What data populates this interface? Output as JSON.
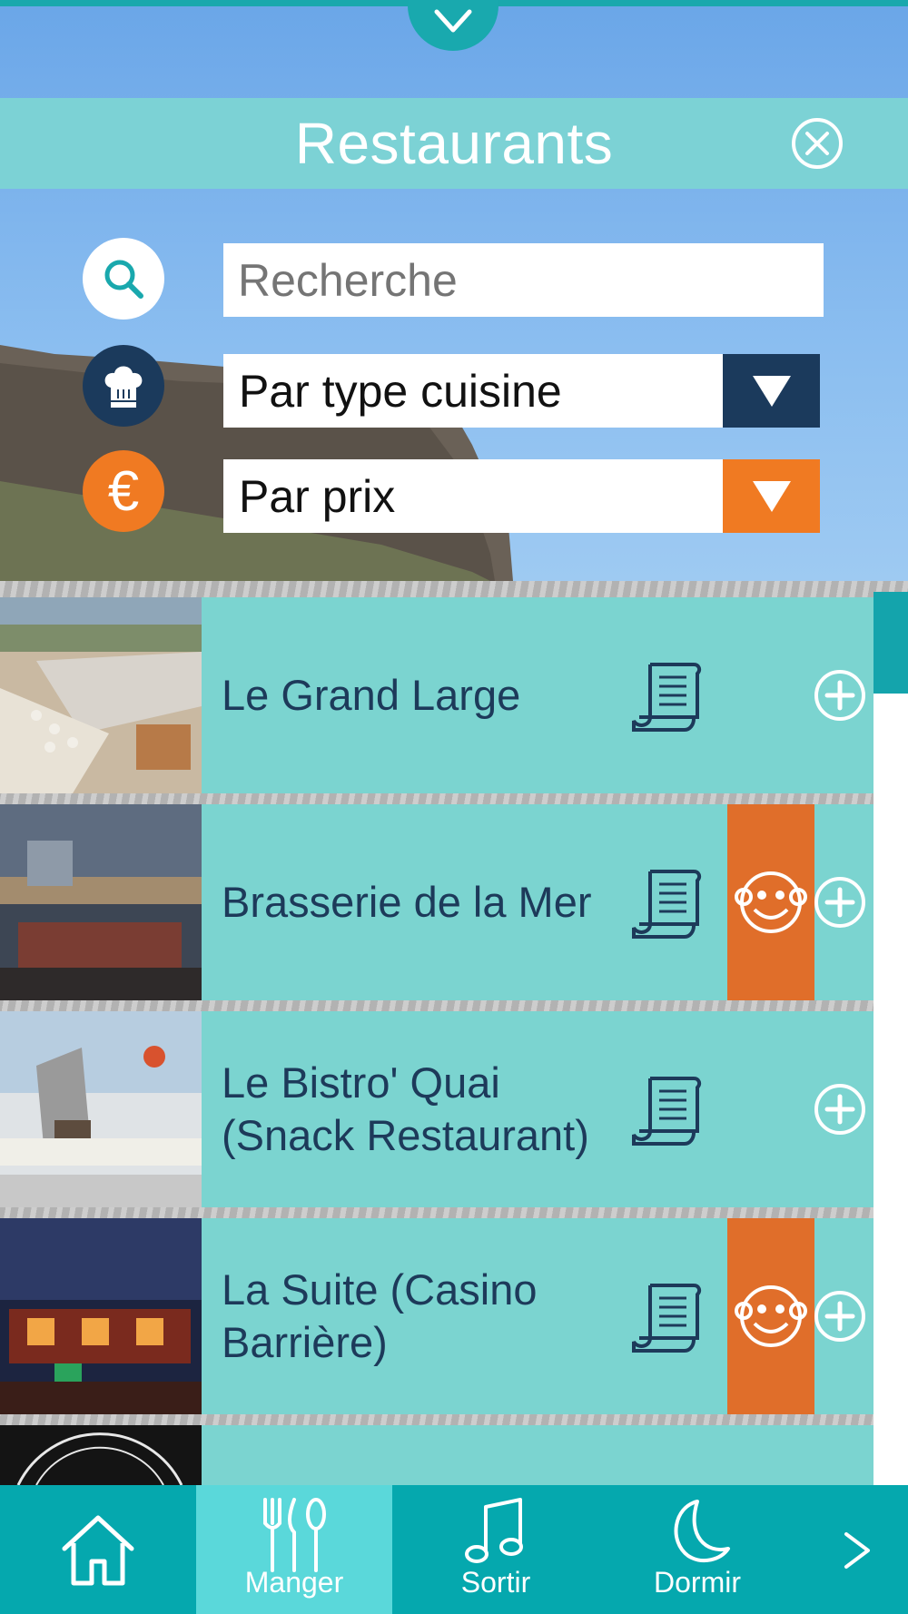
{
  "header": {
    "title": "Restaurants",
    "close_icon": "close-circle-icon",
    "pull_icon": "chevron-down-icon"
  },
  "filters": {
    "search": {
      "placeholder": "Recherche",
      "icon": "search-icon"
    },
    "cuisine": {
      "value": "Par type cuisine",
      "icon": "chef-hat-icon",
      "color": "#1b3a5c"
    },
    "price": {
      "value": "Par prix",
      "icon": "euro-icon",
      "color": "#f07a22"
    }
  },
  "restaurants": [
    {
      "name": "Le Grand Large",
      "has_menu": true,
      "kids": false
    },
    {
      "name": "Brasserie de la Mer",
      "has_menu": true,
      "kids": true
    },
    {
      "name": "Le Bistro' Quai (Snack Restaurant)",
      "has_menu": true,
      "kids": false
    },
    {
      "name": "La Suite (Casino Barrière)",
      "has_menu": true,
      "kids": true
    }
  ],
  "nav": {
    "items": [
      {
        "label": "",
        "icon": "home-icon"
      },
      {
        "label": "Manger",
        "icon": "fork-knife-spoon-icon",
        "active": true
      },
      {
        "label": "Sortir",
        "icon": "music-note-icon"
      },
      {
        "label": "Dormir",
        "icon": "moon-icon"
      }
    ],
    "more_icon": "chevron-right-icon"
  },
  "colors": {
    "accent": "#7bd4d0",
    "nav": "#05a8ae",
    "nav_active": "#5ad8da",
    "kids": "#e06e2a",
    "text_dark": "#1d3a5a"
  }
}
